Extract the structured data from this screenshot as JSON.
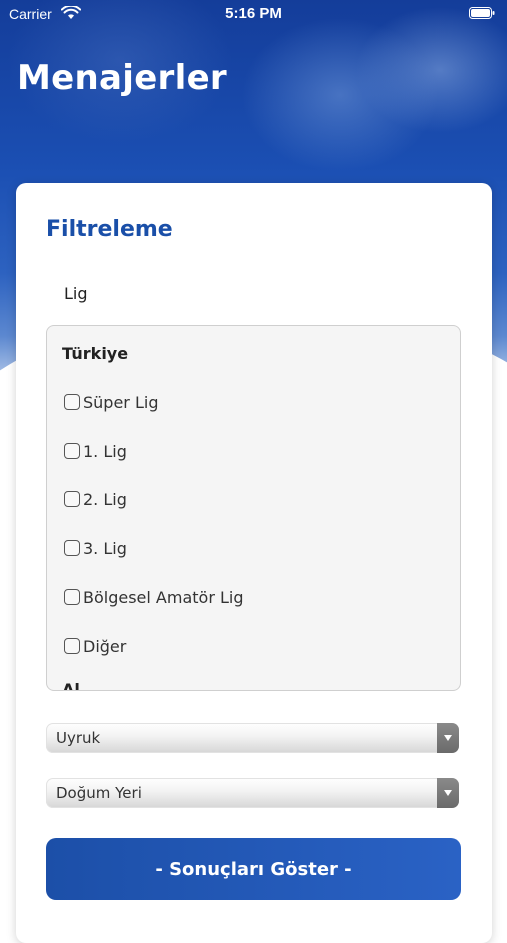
{
  "status_bar": {
    "carrier": "Carrier",
    "time": "5:16 PM",
    "icons": [
      "wifi-icon",
      "battery-icon"
    ]
  },
  "page": {
    "title": "Menajerler"
  },
  "filter": {
    "title": "Filtreleme",
    "league_label": "Lig",
    "groups": [
      {
        "title": "Türkiye",
        "options": [
          "Süper Lig",
          "1. Lig",
          "2. Lig",
          "3. Lig",
          "Bölgesel Amatör Lig",
          "Diğer"
        ]
      },
      {
        "title": "Al..."
      }
    ],
    "nationality_select": "Uyruk",
    "birthplace_select": "Doğum Yeri",
    "submit_label": "- Sonuçları Göster -"
  },
  "colors": {
    "brand_blue": "#1a4fa8",
    "button_blue": "#2a62c5"
  }
}
